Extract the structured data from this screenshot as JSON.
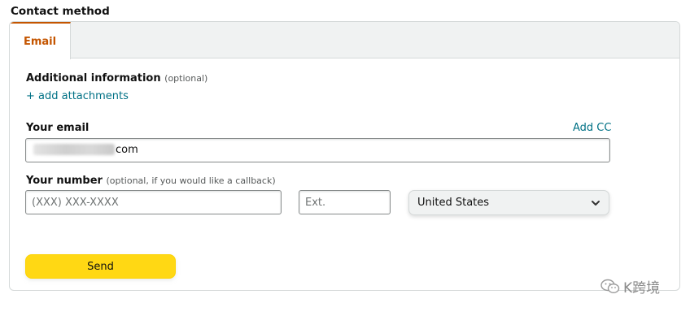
{
  "section_title": "Contact method",
  "tabs": [
    {
      "label": "Email",
      "active": true
    }
  ],
  "additional_info": {
    "label": "Additional information",
    "optional": "(optional)",
    "add_attachments": "+ add attachments"
  },
  "email": {
    "label": "Your email",
    "add_cc": "Add CC",
    "value_visible_suffix": "com"
  },
  "number": {
    "label": "Your number",
    "optional": "(optional, if you would like a callback)",
    "phone_placeholder": "(XXX) XXX-XXXX",
    "ext_placeholder": "Ext.",
    "country": "United States"
  },
  "send_label": "Send",
  "watermark": "K跨境",
  "colors": {
    "accent": "#c45500",
    "link": "#007185",
    "button": "#ffd814"
  }
}
